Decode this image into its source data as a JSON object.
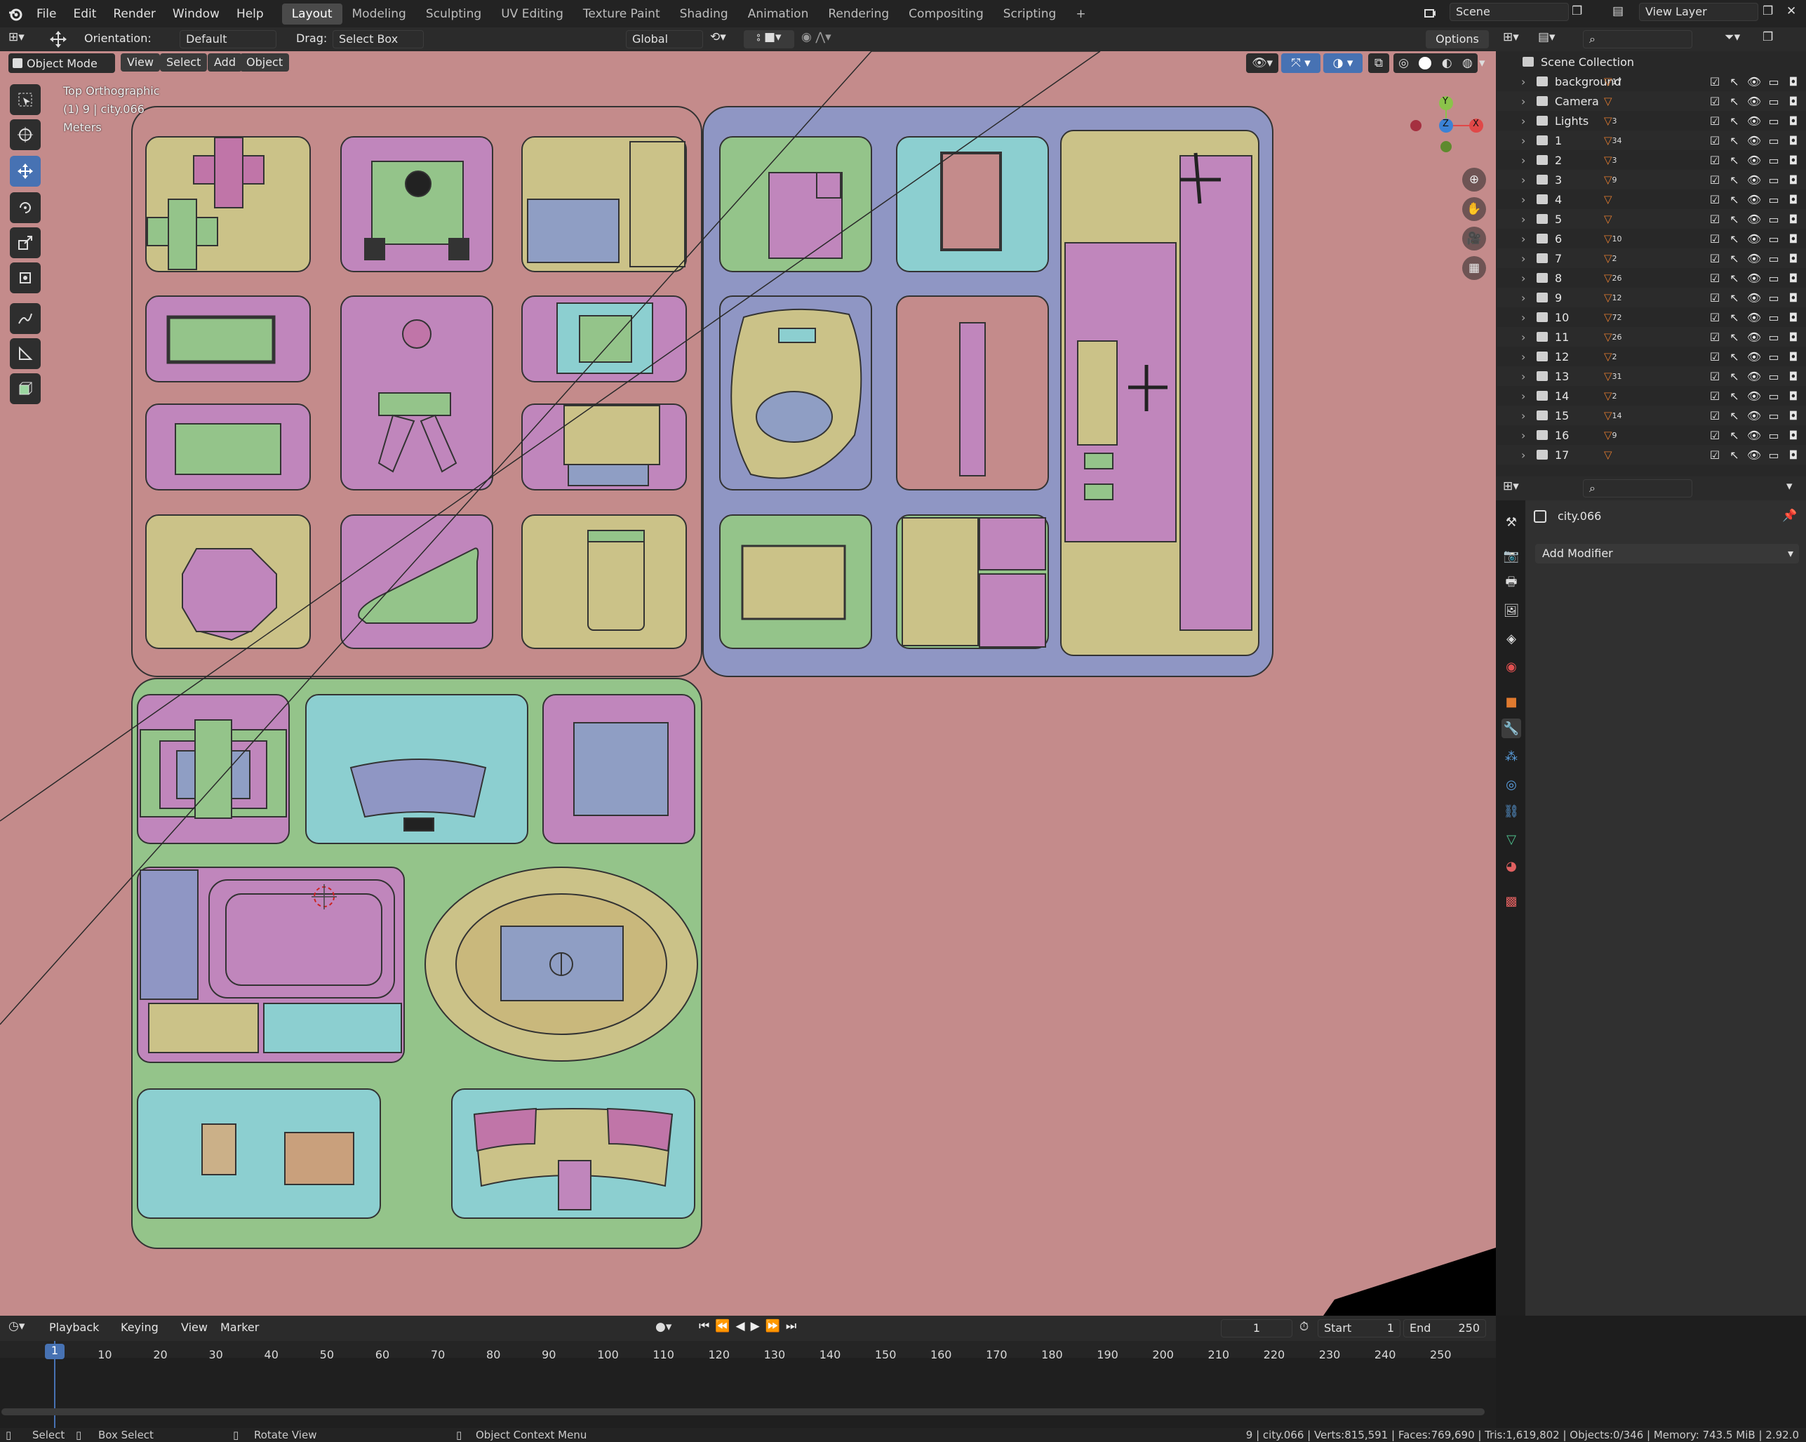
{
  "topbar": {
    "menu": [
      "File",
      "Edit",
      "Render",
      "Window",
      "Help"
    ],
    "workspaces": [
      "Layout",
      "Modeling",
      "Sculpting",
      "UV Editing",
      "Texture Paint",
      "Shading",
      "Animation",
      "Rendering",
      "Compositing",
      "Scripting"
    ],
    "active_workspace": "Layout",
    "add_tab": "+",
    "scene": "Scene",
    "view_layer": "View Layer"
  },
  "tool_header": {
    "orientation_label": "Orientation:",
    "orientation_value": "Default",
    "drag_label": "Drag:",
    "drag_value": "Select Box",
    "transform_orientation": "Global",
    "options": "Options"
  },
  "viewport_header": {
    "mode": "Object Mode",
    "menus": [
      "View",
      "Select",
      "Add",
      "Object"
    ]
  },
  "viewport": {
    "view_name": "Top Orthographic",
    "object_info": "(1) 9 | city.066",
    "units": "Meters",
    "gizmo": {
      "y": "Y",
      "z": "Z",
      "x": "X"
    },
    "bg_color": "#c48b8b"
  },
  "outliner": {
    "root": "Scene Collection",
    "items": [
      {
        "name": "background",
        "count": "17"
      },
      {
        "name": "Camera",
        "count": ""
      },
      {
        "name": "Lights",
        "count": "3"
      },
      {
        "name": "1",
        "count": "34"
      },
      {
        "name": "2",
        "count": "3"
      },
      {
        "name": "3",
        "count": "9"
      },
      {
        "name": "4",
        "count": ""
      },
      {
        "name": "5",
        "count": ""
      },
      {
        "name": "6",
        "count": "10"
      },
      {
        "name": "7",
        "count": "2"
      },
      {
        "name": "8",
        "count": "26"
      },
      {
        "name": "9",
        "count": "12"
      },
      {
        "name": "10",
        "count": "72"
      },
      {
        "name": "11",
        "count": "26"
      },
      {
        "name": "12",
        "count": "2"
      },
      {
        "name": "13",
        "count": "31"
      },
      {
        "name": "14",
        "count": "2"
      },
      {
        "name": "15",
        "count": "14"
      },
      {
        "name": "16",
        "count": "9"
      },
      {
        "name": "17",
        "count": ""
      }
    ]
  },
  "properties": {
    "object_name": "city.066",
    "add_modifier": "Add Modifier"
  },
  "timeline": {
    "menus": [
      "Playback",
      "Keying",
      "View",
      "Marker"
    ],
    "current_frame": "1",
    "start_label": "Start",
    "start": "1",
    "end_label": "End",
    "end": "250",
    "ticks": [
      "1",
      "10",
      "20",
      "30",
      "40",
      "50",
      "60",
      "70",
      "80",
      "90",
      "100",
      "110",
      "120",
      "130",
      "140",
      "150",
      "160",
      "170",
      "180",
      "190",
      "200",
      "210",
      "220",
      "230",
      "240",
      "250"
    ]
  },
  "statusbar": {
    "select": "Select",
    "box_select": "Box Select",
    "rotate_view": "Rotate View",
    "context_menu": "Object Context Menu",
    "stats": "9 | city.066 | Verts:815,591 | Faces:769,690 | Tris:1,619,802 | Objects:0/346 | Memory: 743.5 MiB | 2.92.0"
  }
}
